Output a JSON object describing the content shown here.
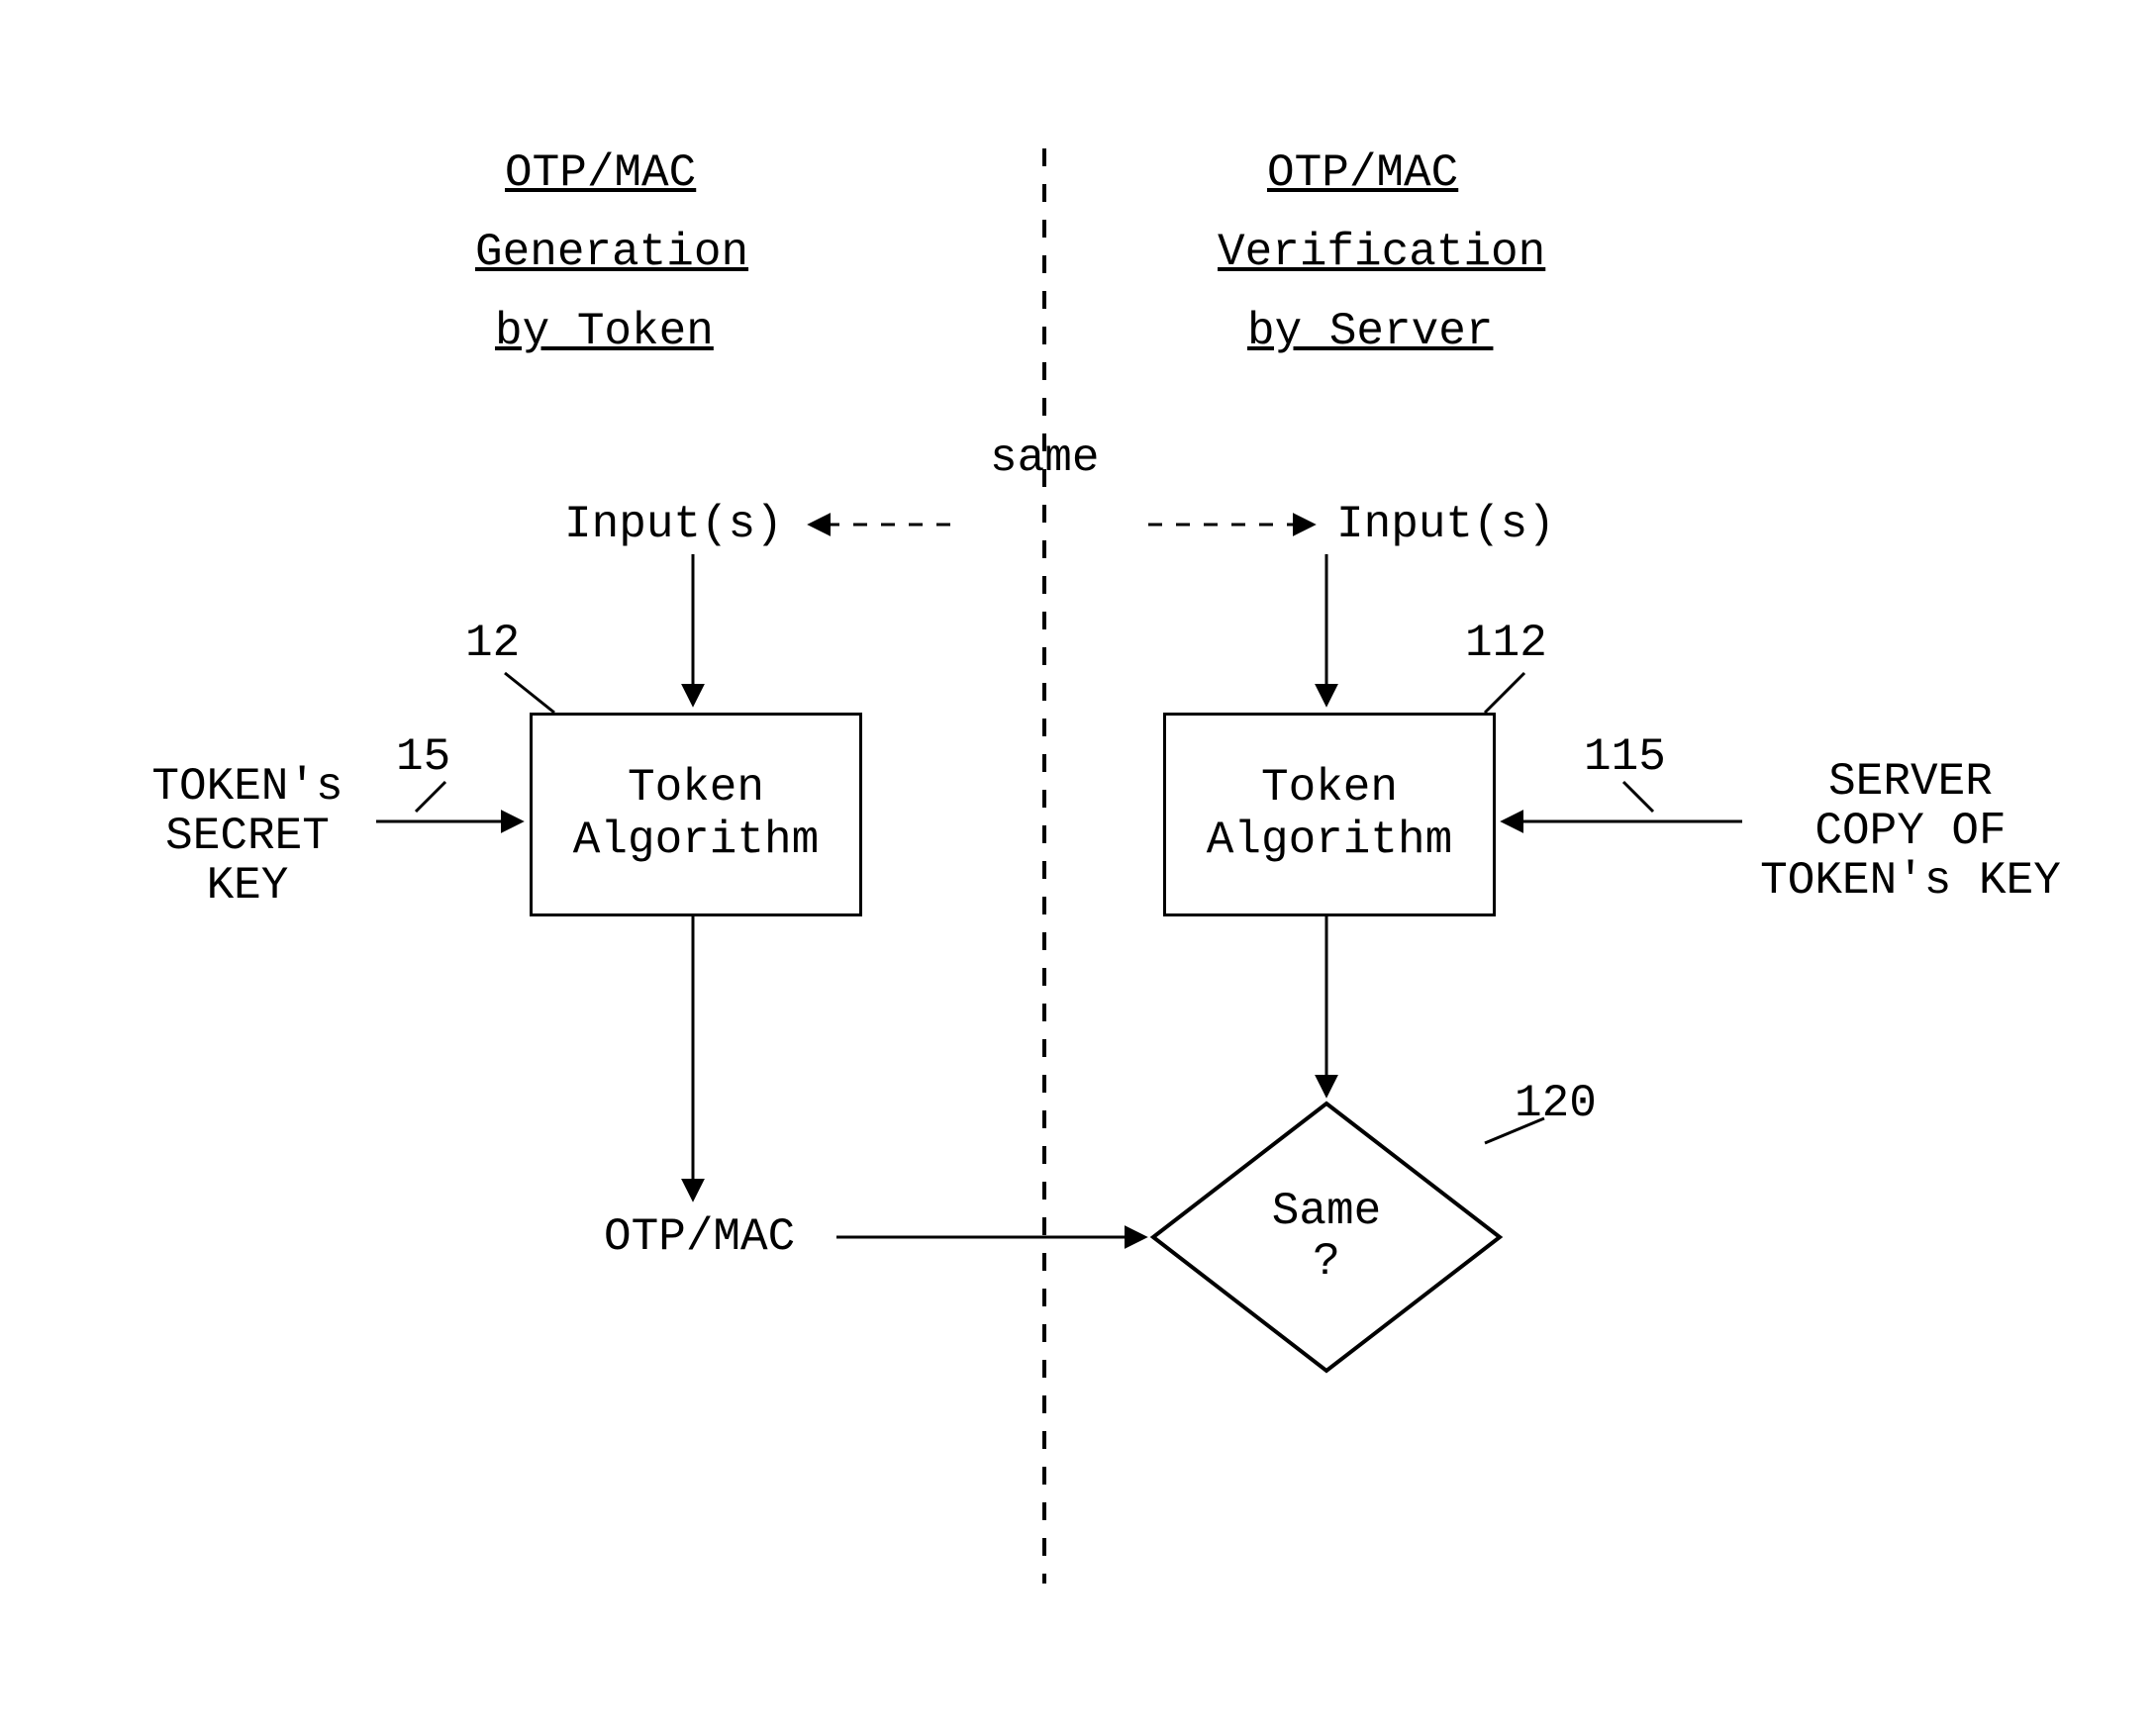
{
  "titles": {
    "left": {
      "l1": "OTP/MAC",
      "l2": "Generation",
      "l3": "by Token"
    },
    "right": {
      "l1": "OTP/MAC",
      "l2": "Verification",
      "l3": "by Server"
    }
  },
  "labels": {
    "same": "same",
    "inputs_left": "Input(s)",
    "inputs_right": "Input(s)",
    "ref12": "12",
    "ref15": "15",
    "ref112": "112",
    "ref115": "115",
    "ref120": "120",
    "token_secret_l1": "TOKEN's",
    "token_secret_l2": "SECRET",
    "token_secret_l3": "KEY",
    "server_copy_l1": "SERVER",
    "server_copy_l2": "COPY OF",
    "server_copy_l3": "TOKEN's KEY",
    "otp_mac": "OTP/MAC",
    "same_q_l1": "Same",
    "same_q_l2": "?"
  },
  "boxes": {
    "token_alg_l1": "Token",
    "token_alg_l2": "Algorithm"
  }
}
